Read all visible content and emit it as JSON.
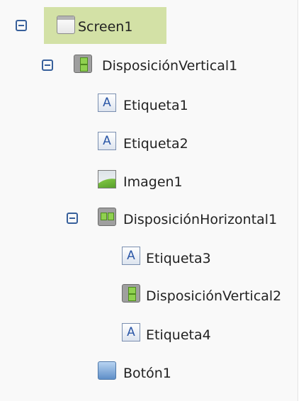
{
  "tree": {
    "screen": {
      "label": "Screen1",
      "icon": "screen-icon"
    },
    "vertical1": {
      "label": "DisposiciónVertical1",
      "icon": "vertical-arrangement-icon"
    },
    "etiqueta1": {
      "label": "Etiqueta1",
      "icon": "label-icon"
    },
    "etiqueta2": {
      "label": "Etiqueta2",
      "icon": "label-icon"
    },
    "imagen1": {
      "label": "Imagen1",
      "icon": "image-icon"
    },
    "horizontal1": {
      "label": "DisposiciónHorizontal1",
      "icon": "horizontal-arrangement-icon"
    },
    "etiqueta3": {
      "label": "Etiqueta3",
      "icon": "label-icon"
    },
    "vertical2": {
      "label": "DisposiciónVertical2",
      "icon": "vertical-arrangement-icon"
    },
    "etiqueta4": {
      "label": "Etiqueta4",
      "icon": "label-icon"
    },
    "boton1": {
      "label": "Botón1",
      "icon": "button-icon"
    }
  },
  "label_icon_glyph": "A",
  "colors": {
    "selected_background": "#d3e1a6",
    "toggle": "#38609b"
  }
}
